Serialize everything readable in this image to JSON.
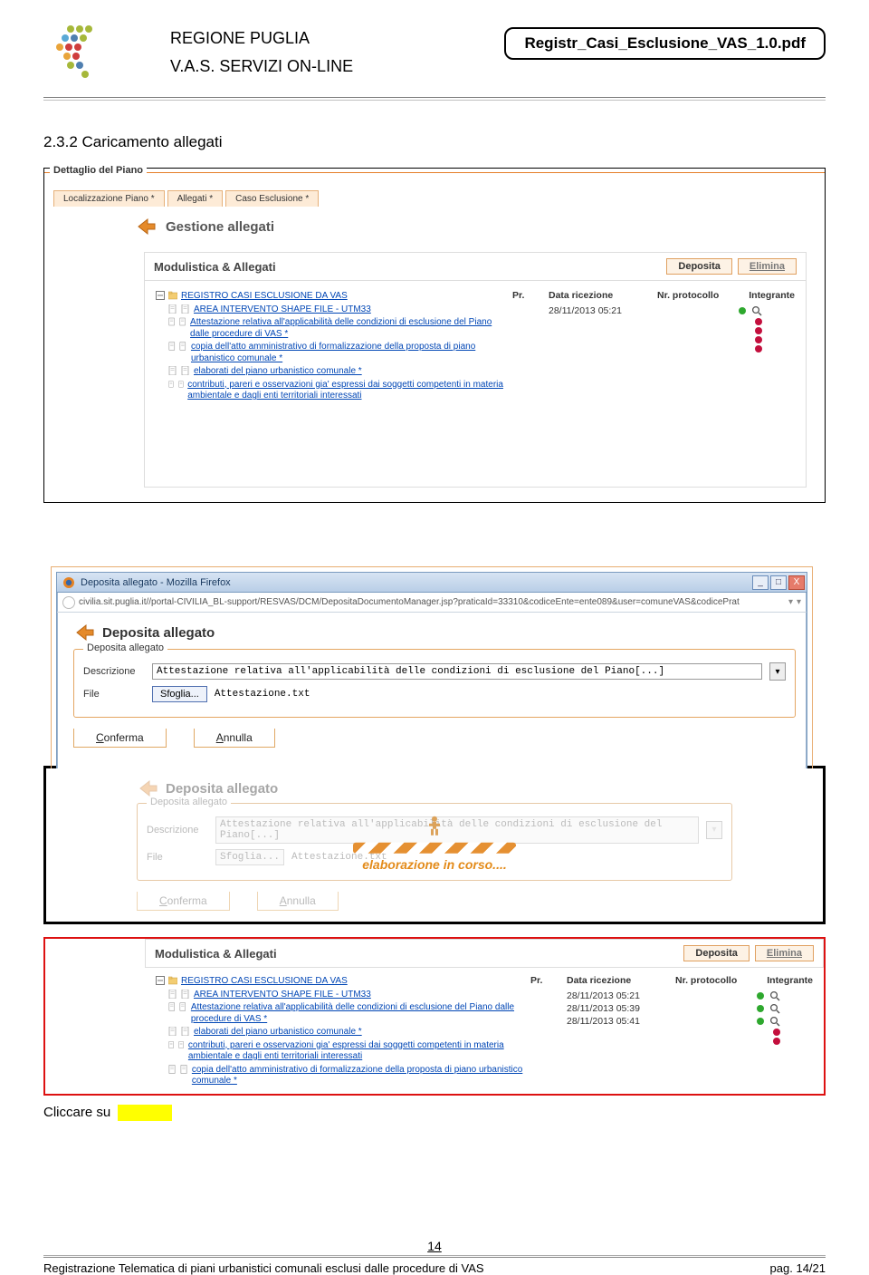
{
  "header": {
    "region": "REGIONE PUGLIA",
    "service": "V.A.S. SERVIZI ON-LINE",
    "filename": "Registr_Casi_Esclusione_VAS_1.0.pdf"
  },
  "section_title": "2.3.2  Caricamento allegati",
  "shot1": {
    "fieldset_title": "Dettaglio del Piano",
    "tabs": [
      "Localizzazione Piano *",
      "Allegati *",
      "Caso Esclusione *"
    ],
    "back_label": "Gestione allegati",
    "panel_title": "Modulistica & Allegati",
    "btn_deposit": "Deposita",
    "btn_delete": "Elimina",
    "cols": {
      "pr": "Pr.",
      "date": "Data ricezione",
      "prot": "Nr. protocollo",
      "integr": "Integrante"
    },
    "tree": [
      "REGISTRO CASI ESCLUSIONE DA VAS",
      "AREA INTERVENTO SHAPE FILE - UTM33",
      "Attestazione relativa all'applicabilità delle condizioni di esclusione del Piano dalle procedure di VAS *",
      "copia dell'atto amministrativo di formalizzazione della proposta di piano urbanistico comunale *",
      "elaborati del piano urbanistico comunale *",
      "contributi, pareri e osservazioni gia' espressi dai soggetti competenti in materia ambientale e dagli enti territoriali interessati"
    ],
    "rows": [
      {
        "date": "28/11/2013 05:21",
        "status": "green",
        "mag": true
      },
      {
        "date": "",
        "status": "red",
        "mag": false
      },
      {
        "date": "",
        "status": "red",
        "mag": false
      },
      {
        "date": "",
        "status": "red",
        "mag": false
      },
      {
        "date": "",
        "status": "red",
        "mag": false
      }
    ]
  },
  "ff": {
    "window_title": "Deposita allegato - Mozilla Firefox",
    "url": "civilia.sit.puglia.it//portal-CIVILIA_BL-support/RESVAS/DCM/DepositaDocumentoManager.jsp?praticaId=33310&codiceEnte=ente089&user=comuneVAS&codicePrat",
    "back_label": "Deposita allegato",
    "fieldset_legend": "Deposita allegato",
    "desc_label": "Descrizione",
    "desc_value": "Attestazione relativa all'applicabilità delle condizioni di esclusione del Piano[...]",
    "file_label": "File",
    "browse_btn": "Sfoglia...",
    "file_value": "Attestazione.txt",
    "confirm": "Conferma",
    "cancel": "Annulla"
  },
  "dim": {
    "back_label": "Deposita allegato",
    "fieldset_legend": "Deposita allegato",
    "desc_label": "Descrizione",
    "desc_value": "Attestazione relativa all'applicabilità delle condizioni di esclusione del Piano[...]",
    "file_label": "File",
    "browse_btn": "Sfoglia...",
    "file_value": "Attestazione.txt",
    "confirm": "Conferma",
    "cancel": "Annulla",
    "overlay_text": "elaborazione in corso...."
  },
  "shot4": {
    "panel_title": "Modulistica & Allegati",
    "btn_deposit": "Deposita",
    "btn_delete": "Elimina",
    "cols": {
      "pr": "Pr.",
      "date": "Data ricezione",
      "prot": "Nr. protocollo",
      "integr": "Integrante"
    },
    "tree": [
      "REGISTRO CASI ESCLUSIONE DA VAS",
      "AREA INTERVENTO SHAPE FILE - UTM33",
      "Attestazione relativa all'applicabilità delle condizioni di esclusione del Piano dalle procedure di VAS *",
      "elaborati del piano urbanistico comunale *",
      "contributi, pareri e osservazioni gia' espressi dai soggetti competenti in materia ambientale e dagli enti territoriali interessati",
      "copia dell'atto amministrativo di formalizzazione della proposta di piano urbanistico comunale *"
    ],
    "rows": [
      {
        "date": "28/11/2013 05:21",
        "status": "green",
        "mag": true
      },
      {
        "date": "28/11/2013 05:39",
        "status": "green",
        "mag": true
      },
      {
        "date": "28/11/2013 05:41",
        "status": "green",
        "mag": true
      },
      {
        "date": "",
        "status": "red",
        "mag": false
      },
      {
        "date": "",
        "status": "red",
        "mag": false
      }
    ]
  },
  "click_text": "Cliccare  su",
  "footer": {
    "page_num": "14",
    "left": "Registrazione Telematica di piani urbanistici comunali esclusi dalle procedure di VAS",
    "right": "pag. 14/21"
  }
}
